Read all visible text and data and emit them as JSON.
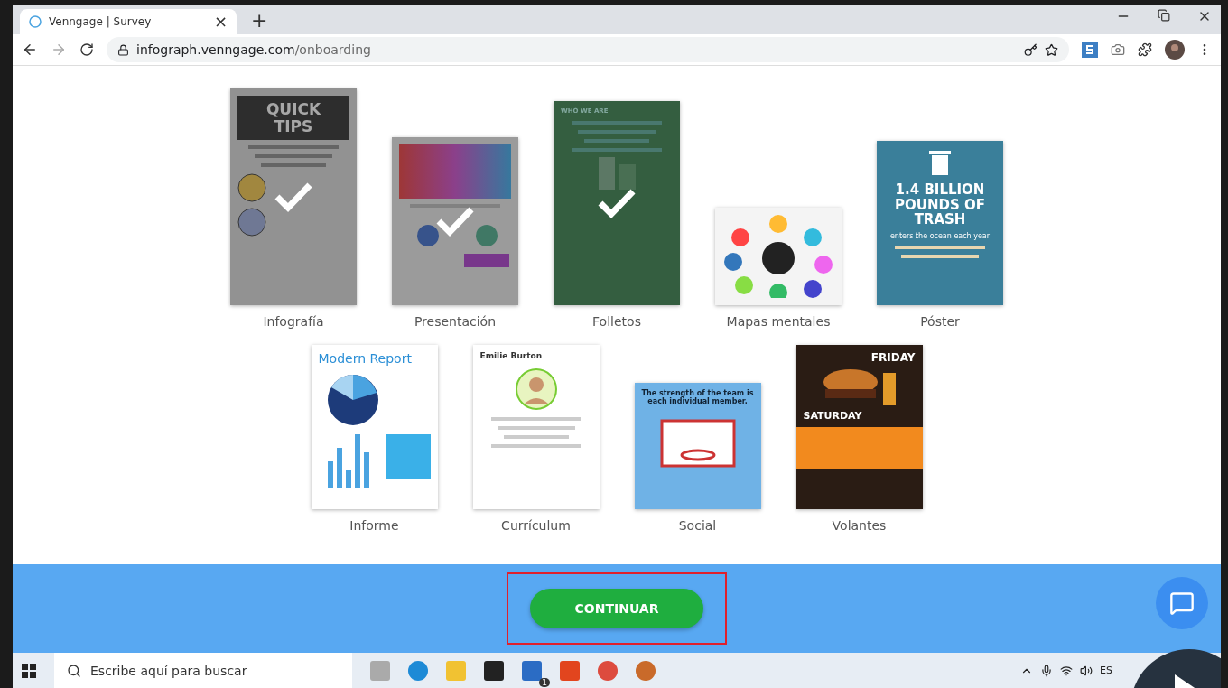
{
  "browser": {
    "tab": {
      "title": "Venngage | Survey",
      "close": "×"
    },
    "new_tab": "+",
    "url": {
      "host": "infograph.venngage.com",
      "path": "/onboarding"
    }
  },
  "rows": [
    [
      {
        "label": "Infografía",
        "selected": true,
        "kind": "infographic",
        "lines": [
          "QUICK TIPS"
        ]
      },
      {
        "label": "Presentación",
        "selected": true,
        "kind": "presentation"
      },
      {
        "label": "Folletos",
        "selected": true,
        "kind": "brochure",
        "lines": [
          "WHO WE ARE"
        ]
      },
      {
        "label": "Mapas mentales",
        "selected": false,
        "kind": "mindmap"
      },
      {
        "label": "Póster",
        "selected": false,
        "kind": "poster",
        "lines": [
          "1.4 BILLION POUNDS OF TRASH",
          "enters the ocean each year"
        ]
      }
    ],
    [
      {
        "label": "Informe",
        "selected": false,
        "kind": "report",
        "lines": [
          "Modern Report"
        ]
      },
      {
        "label": "Currículum",
        "selected": false,
        "kind": "resume",
        "lines": [
          "Emilie Burton"
        ]
      },
      {
        "label": "Social",
        "selected": false,
        "kind": "social",
        "lines": [
          "The strength of the team is each individual member."
        ]
      },
      {
        "label": "Volantes",
        "selected": false,
        "kind": "flyer",
        "lines": [
          "FRIDAY",
          "SATURDAY"
        ]
      }
    ]
  ],
  "continue_button": "CONTINUAR",
  "taskbar": {
    "search_placeholder": "Escribe aquí para buscar",
    "mail_badge": "1",
    "language": "ES"
  }
}
